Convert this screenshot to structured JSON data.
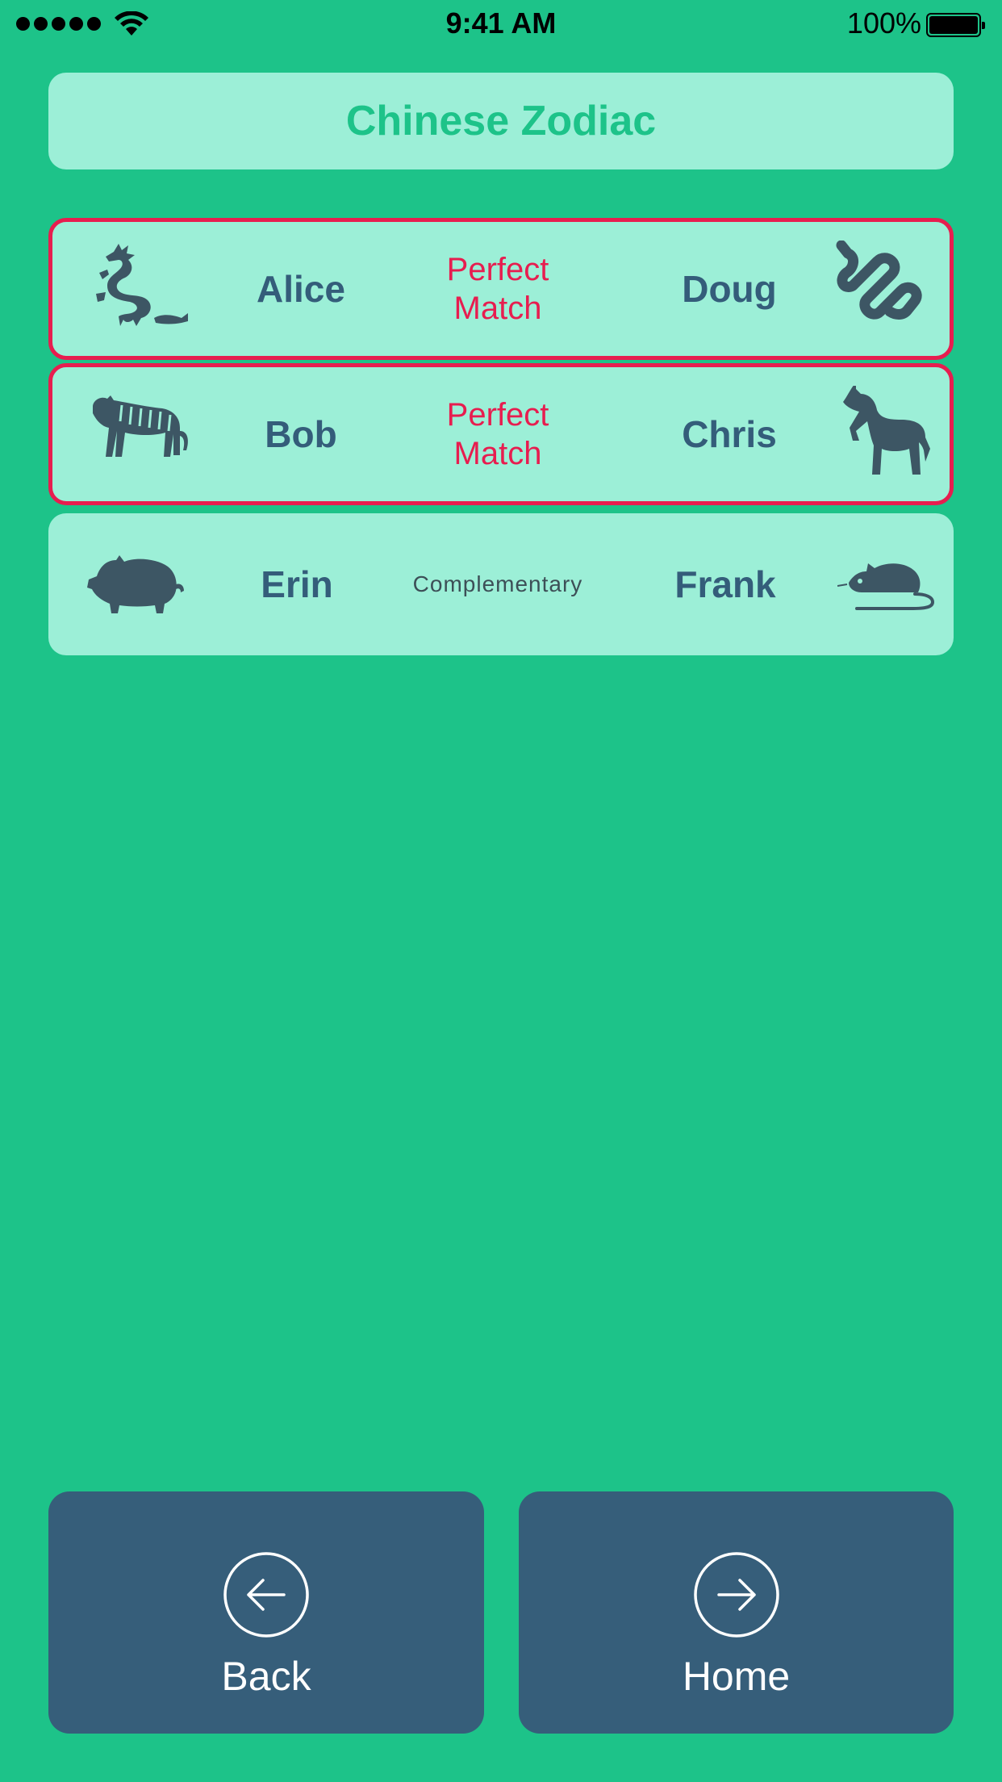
{
  "status_bar": {
    "time": "9:41 AM",
    "battery": "100%"
  },
  "title": "Chinese Zodiac",
  "colors": {
    "background": "#1dc389",
    "card": "#9cefd7",
    "accent": "#e71d4f",
    "name_text": "#345d7a",
    "button": "#365e7a"
  },
  "pairs": [
    {
      "left_name": "Alice",
      "left_icon": "dragon-icon",
      "match": "Perfect Match",
      "match_line1": "Perfect",
      "match_line2": "Match",
      "right_name": "Doug",
      "right_icon": "snake-icon",
      "highlighted": true
    },
    {
      "left_name": "Bob",
      "left_icon": "tiger-icon",
      "match": "Perfect Match",
      "match_line1": "Perfect",
      "match_line2": "Match",
      "right_name": "Chris",
      "right_icon": "horse-icon",
      "highlighted": true
    },
    {
      "left_name": "Erin",
      "left_icon": "pig-icon",
      "match": "Complementary",
      "right_name": "Frank",
      "right_icon": "rat-icon",
      "highlighted": false
    }
  ],
  "buttons": {
    "back": {
      "label": "Back",
      "icon": "arrow-left-circle-icon"
    },
    "home": {
      "label": "Home",
      "icon": "arrow-right-circle-icon"
    }
  }
}
